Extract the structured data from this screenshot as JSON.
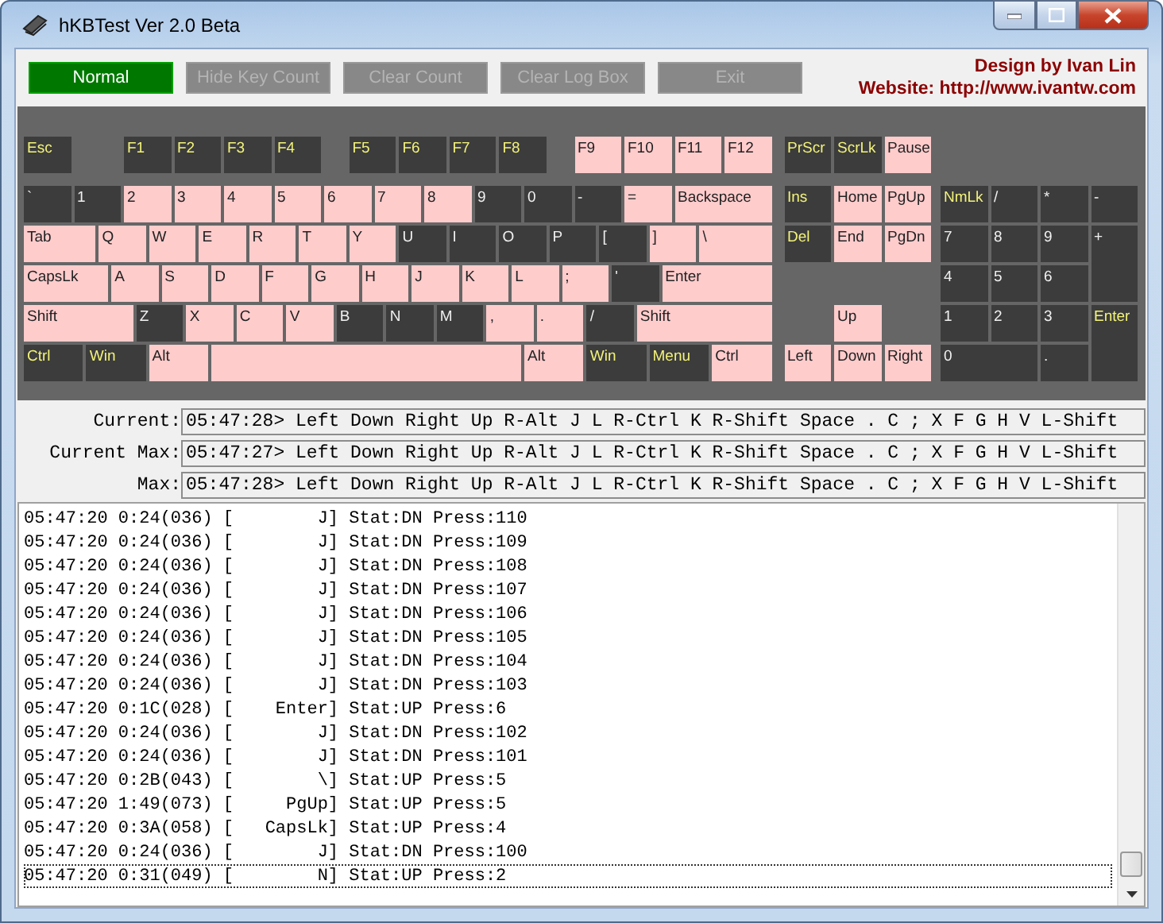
{
  "window": {
    "title": "hKBTest Ver 2.0 Beta"
  },
  "toolbar": {
    "buttons": [
      {
        "label": "Normal",
        "active": true
      },
      {
        "label": "Hide Key Count",
        "active": false
      },
      {
        "label": "Clear Count",
        "active": false
      },
      {
        "label": "Clear Log Box",
        "active": false
      },
      {
        "label": "Exit",
        "active": false
      }
    ],
    "credit": "Design by Ivan Lin",
    "website": "Website: http://www.ivantw.com"
  },
  "keyboard": {
    "main_rows": [
      {
        "keys": [
          {
            "label": "Esc",
            "kind": "name",
            "pressed": false
          },
          {
            "label": "F1",
            "kind": "name",
            "pressed": false
          },
          {
            "label": "F2",
            "kind": "name",
            "pressed": false
          },
          {
            "label": "F3",
            "kind": "name",
            "pressed": false
          },
          {
            "label": "F4",
            "kind": "name",
            "pressed": false
          },
          {
            "label": "F5",
            "kind": "name",
            "pressed": false
          },
          {
            "label": "F6",
            "kind": "name",
            "pressed": false
          },
          {
            "label": "F7",
            "kind": "name",
            "pressed": false
          },
          {
            "label": "F8",
            "kind": "name",
            "pressed": false
          },
          {
            "label": "F9",
            "kind": "name",
            "pressed": true
          },
          {
            "label": "F10",
            "kind": "name",
            "pressed": true
          },
          {
            "label": "F11",
            "kind": "name",
            "pressed": true
          },
          {
            "label": "F12",
            "kind": "name",
            "pressed": true
          }
        ]
      },
      {
        "keys": [
          {
            "label": "`",
            "kind": "char",
            "pressed": false
          },
          {
            "label": "1",
            "kind": "char",
            "pressed": false
          },
          {
            "label": "2",
            "kind": "char",
            "pressed": true
          },
          {
            "label": "3",
            "kind": "char",
            "pressed": true
          },
          {
            "label": "4",
            "kind": "char",
            "pressed": true
          },
          {
            "label": "5",
            "kind": "char",
            "pressed": true
          },
          {
            "label": "6",
            "kind": "char",
            "pressed": true
          },
          {
            "label": "7",
            "kind": "char",
            "pressed": true
          },
          {
            "label": "8",
            "kind": "char",
            "pressed": true
          },
          {
            "label": "9",
            "kind": "char",
            "pressed": false
          },
          {
            "label": "0",
            "kind": "char",
            "pressed": false
          },
          {
            "label": "-",
            "kind": "char",
            "pressed": false
          },
          {
            "label": "=",
            "kind": "char",
            "pressed": true
          },
          {
            "label": "Backspace",
            "kind": "name",
            "pressed": true
          }
        ]
      },
      {
        "keys": [
          {
            "label": "Tab",
            "kind": "name",
            "pressed": true
          },
          {
            "label": "Q",
            "kind": "char",
            "pressed": true
          },
          {
            "label": "W",
            "kind": "char",
            "pressed": true
          },
          {
            "label": "E",
            "kind": "char",
            "pressed": true
          },
          {
            "label": "R",
            "kind": "char",
            "pressed": true
          },
          {
            "label": "T",
            "kind": "char",
            "pressed": true
          },
          {
            "label": "Y",
            "kind": "char",
            "pressed": true
          },
          {
            "label": "U",
            "kind": "char",
            "pressed": false
          },
          {
            "label": "I",
            "kind": "char",
            "pressed": false
          },
          {
            "label": "O",
            "kind": "char",
            "pressed": false
          },
          {
            "label": "P",
            "kind": "char",
            "pressed": false
          },
          {
            "label": "[",
            "kind": "char",
            "pressed": false
          },
          {
            "label": "]",
            "kind": "char",
            "pressed": true
          },
          {
            "label": "\\",
            "kind": "char",
            "pressed": true
          }
        ]
      },
      {
        "keys": [
          {
            "label": "CapsLk",
            "kind": "name",
            "pressed": true
          },
          {
            "label": "A",
            "kind": "char",
            "pressed": true
          },
          {
            "label": "S",
            "kind": "char",
            "pressed": true
          },
          {
            "label": "D",
            "kind": "char",
            "pressed": true
          },
          {
            "label": "F",
            "kind": "char",
            "pressed": true
          },
          {
            "label": "G",
            "kind": "char",
            "pressed": true
          },
          {
            "label": "H",
            "kind": "char",
            "pressed": true
          },
          {
            "label": "J",
            "kind": "char",
            "pressed": true
          },
          {
            "label": "K",
            "kind": "char",
            "pressed": true
          },
          {
            "label": "L",
            "kind": "char",
            "pressed": true
          },
          {
            "label": ";",
            "kind": "char",
            "pressed": true
          },
          {
            "label": "'",
            "kind": "char",
            "pressed": false
          },
          {
            "label": "Enter",
            "kind": "name",
            "pressed": true
          }
        ]
      },
      {
        "keys": [
          {
            "label": "Shift",
            "kind": "name",
            "pressed": true
          },
          {
            "label": "Z",
            "kind": "char",
            "pressed": false
          },
          {
            "label": "X",
            "kind": "char",
            "pressed": true
          },
          {
            "label": "C",
            "kind": "char",
            "pressed": true
          },
          {
            "label": "V",
            "kind": "char",
            "pressed": true
          },
          {
            "label": "B",
            "kind": "char",
            "pressed": false
          },
          {
            "label": "N",
            "kind": "char",
            "pressed": false
          },
          {
            "label": "M",
            "kind": "char",
            "pressed": false
          },
          {
            "label": ",",
            "kind": "char",
            "pressed": true
          },
          {
            "label": ".",
            "kind": "char",
            "pressed": true
          },
          {
            "label": "/",
            "kind": "char",
            "pressed": false
          },
          {
            "label": "Shift",
            "kind": "name",
            "pressed": true
          }
        ]
      },
      {
        "keys": [
          {
            "label": "Ctrl",
            "kind": "name",
            "pressed": false
          },
          {
            "label": "Win",
            "kind": "name",
            "pressed": false
          },
          {
            "label": "Alt",
            "kind": "name",
            "pressed": true
          },
          {
            "kind": "name",
            "pressed": true
          },
          {
            "label": "Alt",
            "kind": "name",
            "pressed": true
          },
          {
            "label": "Win",
            "kind": "name",
            "pressed": false
          },
          {
            "label": "Menu",
            "kind": "name",
            "pressed": false
          },
          {
            "label": "Ctrl",
            "kind": "name",
            "pressed": true
          }
        ]
      }
    ],
    "nav_keys": [
      {
        "label": "PrScr",
        "kind": "name",
        "pressed": false
      },
      {
        "label": "ScrLk",
        "kind": "name",
        "pressed": false
      },
      {
        "label": "Pause",
        "kind": "name",
        "pressed": true
      },
      {
        "label": "Ins",
        "kind": "name",
        "pressed": false
      },
      {
        "label": "Home",
        "kind": "name",
        "pressed": true
      },
      {
        "label": "PgUp",
        "kind": "name",
        "pressed": true
      },
      {
        "label": "Del",
        "kind": "name",
        "pressed": false
      },
      {
        "label": "End",
        "kind": "name",
        "pressed": true
      },
      {
        "label": "PgDn",
        "kind": "name",
        "pressed": true
      },
      {
        "label": "Up",
        "kind": "name",
        "pressed": true
      },
      {
        "label": "Left",
        "kind": "name",
        "pressed": true
      },
      {
        "label": "Down",
        "kind": "name",
        "pressed": true
      },
      {
        "label": "Right",
        "kind": "name",
        "pressed": true
      }
    ],
    "numpad_keys": [
      {
        "label": "NmLk",
        "kind": "name",
        "pressed": false
      },
      {
        "label": "/",
        "kind": "char",
        "pressed": false
      },
      {
        "label": "*",
        "kind": "char",
        "pressed": false
      },
      {
        "label": "-",
        "kind": "char",
        "pressed": false
      },
      {
        "label": "7",
        "kind": "char",
        "pressed": false
      },
      {
        "label": "8",
        "kind": "char",
        "pressed": false
      },
      {
        "label": "9",
        "kind": "char",
        "pressed": false
      },
      {
        "label": "+",
        "kind": "char",
        "pressed": false
      },
      {
        "label": "4",
        "kind": "char",
        "pressed": false
      },
      {
        "label": "5",
        "kind": "char",
        "pressed": false
      },
      {
        "label": "6",
        "kind": "char",
        "pressed": false
      },
      {
        "label": "1",
        "kind": "char",
        "pressed": false
      },
      {
        "label": "2",
        "kind": "char",
        "pressed": false
      },
      {
        "label": "3",
        "kind": "char",
        "pressed": false
      },
      {
        "label": "Enter",
        "kind": "name",
        "pressed": false
      },
      {
        "label": "0",
        "kind": "char",
        "pressed": false
      },
      {
        "label": ".",
        "kind": "char",
        "pressed": false
      }
    ]
  },
  "status": [
    {
      "label": "Current:",
      "value": "05:47:28> Left Down Right Up R-Alt J L R-Ctrl K R-Shift Space . C ; X F G H V L-Shift"
    },
    {
      "label": "Current Max:",
      "value": "05:47:27> Left Down Right Up R-Alt J L R-Ctrl K R-Shift Space . C ; X F G H V L-Shift"
    },
    {
      "label": "Max:",
      "value": "05:47:28> Left Down Right Up R-Alt J L R-Ctrl K R-Shift Space . C ; X F G H V L-Shift"
    }
  ],
  "log": [
    {
      "text": "05:47:20 0:24(036) [        J] Stat:DN Press:110",
      "selected": false
    },
    {
      "text": "05:47:20 0:24(036) [        J] Stat:DN Press:109",
      "selected": false
    },
    {
      "text": "05:47:20 0:24(036) [        J] Stat:DN Press:108",
      "selected": false
    },
    {
      "text": "05:47:20 0:24(036) [        J] Stat:DN Press:107",
      "selected": false
    },
    {
      "text": "05:47:20 0:24(036) [        J] Stat:DN Press:106",
      "selected": false
    },
    {
      "text": "05:47:20 0:24(036) [        J] Stat:DN Press:105",
      "selected": false
    },
    {
      "text": "05:47:20 0:24(036) [        J] Stat:DN Press:104",
      "selected": false
    },
    {
      "text": "05:47:20 0:24(036) [        J] Stat:DN Press:103",
      "selected": false
    },
    {
      "text": "05:47:20 0:1C(028) [    Enter] Stat:UP Press:6",
      "selected": false
    },
    {
      "text": "05:47:20 0:24(036) [        J] Stat:DN Press:102",
      "selected": false
    },
    {
      "text": "05:47:20 0:24(036) [        J] Stat:DN Press:101",
      "selected": false
    },
    {
      "text": "05:47:20 0:2B(043) [        \\] Stat:UP Press:5",
      "selected": false
    },
    {
      "text": "05:47:20 1:49(073) [     PgUp] Stat:UP Press:5",
      "selected": false
    },
    {
      "text": "05:47:20 0:3A(058) [   CapsLk] Stat:UP Press:4",
      "selected": false
    },
    {
      "text": "05:47:20 0:24(036) [        J] Stat:DN Press:100",
      "selected": false
    },
    {
      "text": "05:47:20 0:31(049) [        N] Stat:UP Press:2",
      "selected": true
    }
  ]
}
